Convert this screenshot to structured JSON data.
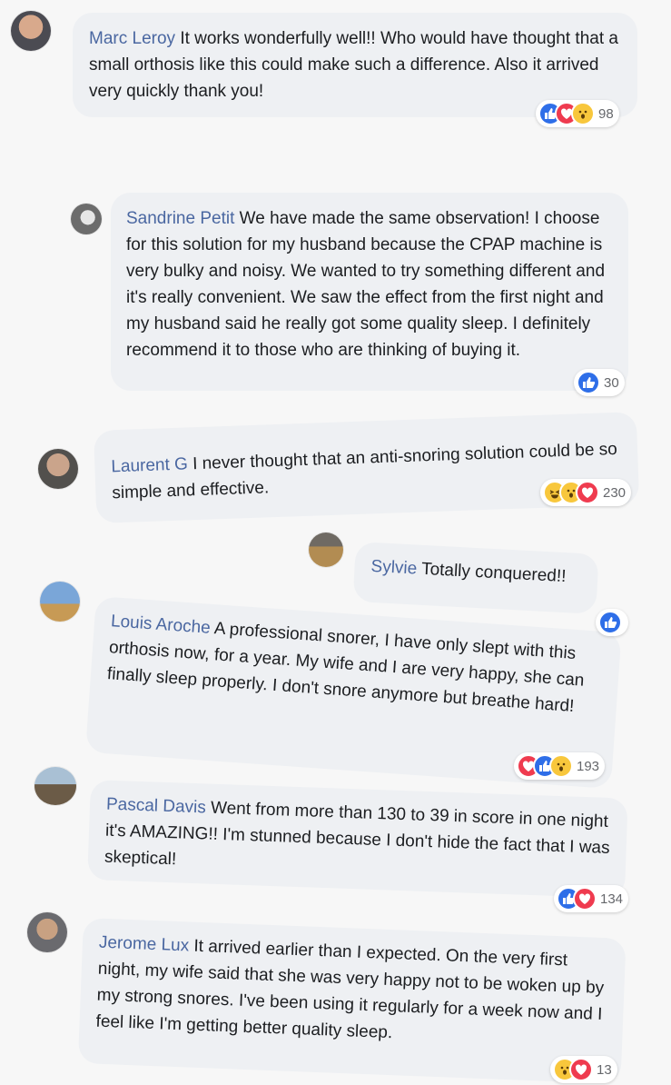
{
  "comments": [
    {
      "author": "Marc Leroy",
      "text": "It works wonderfully well!! Who would have thought that a small orthosis like this could make such a difference. Also it arrived very quickly thank you!",
      "reactions": [
        "like",
        "love",
        "wow"
      ],
      "count": "98"
    },
    {
      "author": "Sandrine Petit",
      "text": "We have made the same observation! I choose for this solution for my husband because the CPAP machine is very bulky and noisy. We wanted to try something different and it's really convenient. We saw the effect from the first night and my husband said he really got some quality sleep. I definitely recommend it to those who are thinking of buying it.",
      "reactions": [
        "like"
      ],
      "count": "30"
    },
    {
      "author": "Laurent G",
      "text": "I never thought that an anti-snoring solution could be so simple and effective.",
      "reactions": [
        "haha",
        "wow",
        "love"
      ],
      "count": "230"
    },
    {
      "author": "Sylvie",
      "text": "Totally conquered!!",
      "reactions": [],
      "count": ""
    },
    {
      "author": "Louis Aroche",
      "text": "A professional snorer, I have only slept with this orthosis now, for a year. My wife and I are very happy, she can finally sleep properly. I don't snore anymore but breathe hard!",
      "reactions": [
        "like"
      ],
      "count": ""
    },
    {
      "author": "Pascal Davis",
      "text": "Went from more than 130 to 39 in score in one night it's AMAZING!! I'm stunned because I don't hide the fact that I was skeptical!",
      "reactions": [
        "love",
        "like",
        "wow"
      ],
      "count": "193"
    },
    {
      "author": "Jerome Lux",
      "text": "It arrived earlier than I expected. On the very first night, my wife said that she was very happy not to be woken up by my strong snores. I've been using it regularly for a week now and I feel like I'm getting better quality sleep.",
      "reactions": [
        "like",
        "love"
      ],
      "count": "134"
    },
    {
      "author": "",
      "text": "",
      "reactions": [
        "wow",
        "love"
      ],
      "count": "13"
    }
  ],
  "colors": {
    "author": "#4a67a1",
    "bubble": "#eef0f3",
    "like": "#2e6ee8",
    "love": "#ef3b4f",
    "wow": "#f8c73c"
  },
  "icons": {
    "like": "thumbs-up-icon",
    "love": "heart-icon",
    "wow": "surprised-face-icon",
    "haha": "laughing-face-icon"
  }
}
